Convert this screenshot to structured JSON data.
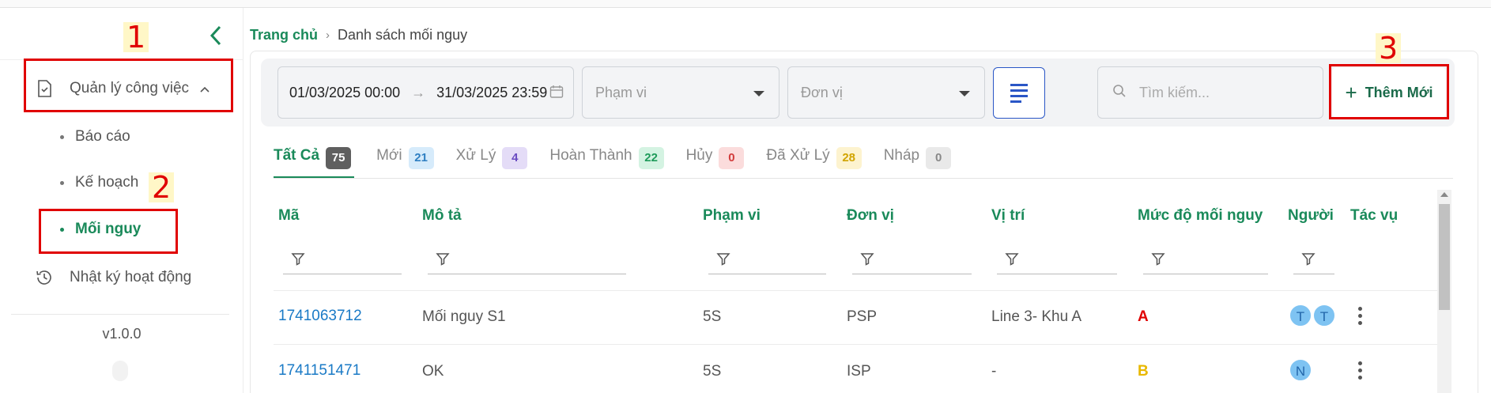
{
  "sidebar": {
    "collapse_icon": "chevron-left-icon",
    "menu": [
      {
        "label": "Quản lý công việc",
        "icon": "task-file-icon",
        "expanded": true
      },
      {
        "label": "Nhật ký hoạt động",
        "icon": "history-icon"
      }
    ],
    "sub_items": [
      {
        "label": "Báo cáo",
        "active": false
      },
      {
        "label": "Kế hoạch",
        "active": false
      },
      {
        "label": "Mối nguy",
        "active": true
      }
    ],
    "version": "v1.0.0"
  },
  "annotations": [
    "1",
    "2",
    "3"
  ],
  "breadcrumb": {
    "home": "Trang chủ",
    "current": "Danh sách mối nguy"
  },
  "filters": {
    "date_from": "01/03/2025 00:00",
    "date_to": "31/03/2025 23:59",
    "scope_placeholder": "Phạm vi",
    "unit_placeholder": "Đơn vị",
    "search_placeholder": "Tìm kiếm...",
    "add_label": "Thêm Mới"
  },
  "tabs": [
    {
      "label": "Tất Cả",
      "count": "75",
      "active": true,
      "badge_bg": "#5f5f5f",
      "badge_fg": "#ffffff"
    },
    {
      "label": "Mới",
      "count": "21",
      "badge_bg": "#d6ebfb",
      "badge_fg": "#2f7fc2"
    },
    {
      "label": "Xử Lý",
      "count": "4",
      "badge_bg": "#e4dcf7",
      "badge_fg": "#6a4cc2"
    },
    {
      "label": "Hoàn Thành",
      "count": "22",
      "badge_bg": "#d4f3e2",
      "badge_fg": "#1f9b5a"
    },
    {
      "label": "Hủy",
      "count": "0",
      "badge_bg": "#fbdcdc",
      "badge_fg": "#d23c3c"
    },
    {
      "label": "Đã Xử Lý",
      "count": "28",
      "badge_bg": "#fdf3cf",
      "badge_fg": "#d1a400"
    },
    {
      "label": "Nháp",
      "count": "0",
      "badge_bg": "#e9e9e9",
      "badge_fg": "#888888"
    }
  ],
  "table": {
    "columns": [
      "Mã",
      "Mô tả",
      "Phạm vi",
      "Đơn vị",
      "Vị trí",
      "Mức độ mối nguy",
      "Người x",
      "Tác vụ"
    ],
    "rows": [
      {
        "code": "1741063712",
        "desc": "Mối nguy S1",
        "scope": "5S",
        "unit": "PSP",
        "location": "Line 3- Khu A",
        "level": "A",
        "level_color": "#e00000",
        "people": [
          "T",
          "T"
        ]
      },
      {
        "code": "1741151471",
        "desc": "OK",
        "scope": "5S",
        "unit": "ISP",
        "location": "-",
        "level": "B",
        "level_color": "#e8b800",
        "people": [
          "N"
        ]
      }
    ]
  },
  "colors": {
    "brand_green": "#1a8a5a",
    "link_blue": "#1a7ac6",
    "highlight_red": "#e00000"
  }
}
